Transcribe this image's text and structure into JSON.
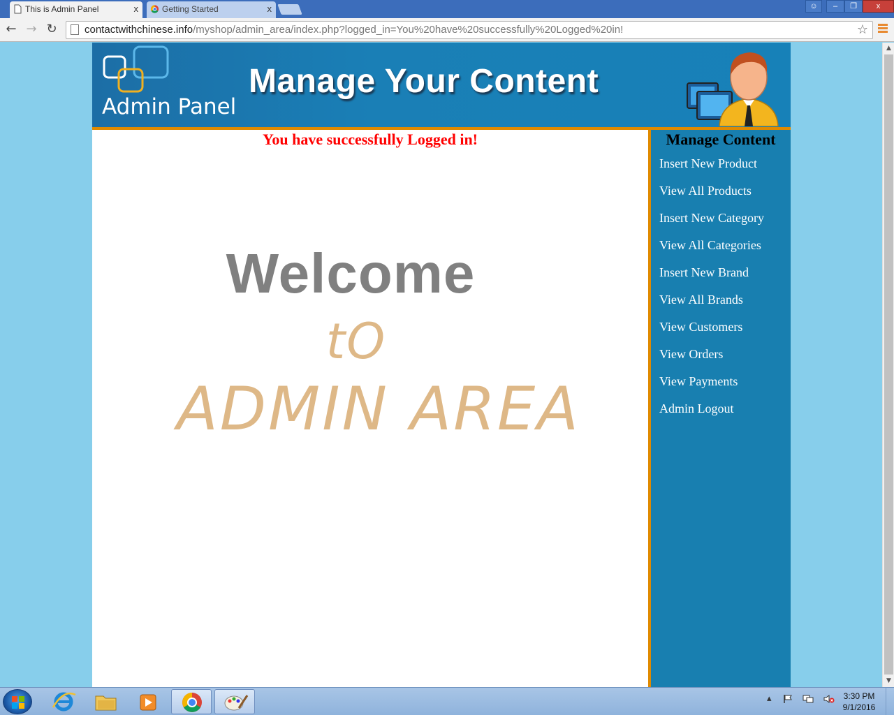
{
  "browser": {
    "tabs": [
      {
        "title": "This is Admin Panel",
        "active": true
      },
      {
        "title": "Getting Started",
        "active": false
      }
    ],
    "close_glyph": "x",
    "window_buttons": {
      "user": "☺",
      "minimize": "–",
      "maximize": "❐",
      "close": "x"
    },
    "nav": {
      "back": "←",
      "forward": "→",
      "reload": "↻"
    },
    "url": {
      "host": "contactwithchinese.info",
      "path": "/myshop/admin_area/index.php?logged_in=You%20have%20successfully%20Logged%20in!"
    },
    "bookmark_glyph": "☆"
  },
  "header": {
    "logo_text": "Admin Panel",
    "title": "Manage Your Content"
  },
  "main": {
    "success_message": "You have successfully Logged in!",
    "welcome": "Welcome",
    "to": "tO",
    "admin_area": "ADMIN AREA"
  },
  "sidebar": {
    "title": "Manage Content",
    "items": [
      {
        "label": "Insert New Product"
      },
      {
        "label": "View All Products"
      },
      {
        "label": "Insert New Category"
      },
      {
        "label": "View All Categories"
      },
      {
        "label": "Insert New Brand"
      },
      {
        "label": "View All Brands"
      },
      {
        "label": "View Customers"
      },
      {
        "label": "View Orders"
      },
      {
        "label": "View Payments"
      },
      {
        "label": "Admin Logout"
      }
    ]
  },
  "scrollbar": {
    "up": "▲",
    "down": "▼"
  },
  "taskbar": {
    "tray_up": "▴",
    "clock_time": "3:30 PM",
    "clock_date": "9/1/2016"
  },
  "colors": {
    "page_bg": "#87ceeb",
    "header_bg": "#187fb0",
    "accent_border": "#e08a00",
    "success": "#ff0000",
    "welcome": "#808080",
    "admin_area": "#deb887"
  }
}
